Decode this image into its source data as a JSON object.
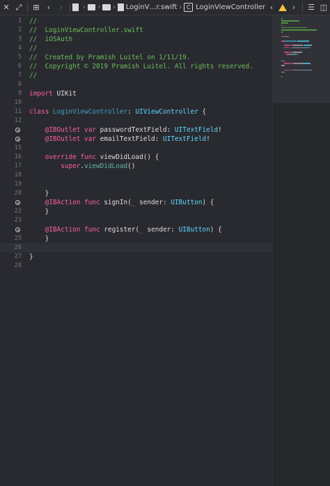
{
  "toolbar": {
    "breadcrumb_file": "LoginV…r.swift",
    "breadcrumb_symbol": "LoginViewController",
    "class_badge": "C"
  },
  "editor": {
    "current_line": 26,
    "lines": [
      {
        "n": "1",
        "bp": false,
        "tokens": [
          {
            "c": "c-comment",
            "t": "//"
          }
        ]
      },
      {
        "n": "2",
        "bp": false,
        "tokens": [
          {
            "c": "c-comment",
            "t": "//  LoginViewController.swift"
          }
        ]
      },
      {
        "n": "3",
        "bp": false,
        "tokens": [
          {
            "c": "c-comment",
            "t": "//  iOSAuth"
          }
        ]
      },
      {
        "n": "4",
        "bp": false,
        "tokens": [
          {
            "c": "c-comment",
            "t": "//"
          }
        ]
      },
      {
        "n": "5",
        "bp": false,
        "tokens": [
          {
            "c": "c-comment",
            "t": "//  Created by Pramish Luitel on 1/11/19."
          }
        ]
      },
      {
        "n": "6",
        "bp": false,
        "tokens": [
          {
            "c": "c-comment",
            "t": "//  Copyright © 2019 Pramish Luitel. All rights reserved."
          }
        ]
      },
      {
        "n": "7",
        "bp": false,
        "tokens": [
          {
            "c": "c-comment",
            "t": "//"
          }
        ]
      },
      {
        "n": "8",
        "bp": false,
        "tokens": []
      },
      {
        "n": "9",
        "bp": false,
        "tokens": [
          {
            "c": "c-kw",
            "t": "import"
          },
          {
            "c": "c-plain",
            "t": " UIKit"
          }
        ]
      },
      {
        "n": "10",
        "bp": false,
        "tokens": []
      },
      {
        "n": "11",
        "bp": false,
        "tokens": [
          {
            "c": "c-kw",
            "t": "class"
          },
          {
            "c": "c-plain",
            "t": " "
          },
          {
            "c": "c-decl",
            "t": "LoginViewController"
          },
          {
            "c": "c-plain",
            "t": ": "
          },
          {
            "c": "c-type",
            "t": "UIViewController"
          },
          {
            "c": "c-plain",
            "t": " {"
          }
        ]
      },
      {
        "n": "12",
        "bp": false,
        "tokens": []
      },
      {
        "n": "",
        "bp": true,
        "tokens": [
          {
            "c": "c-plain",
            "t": "    "
          },
          {
            "c": "c-kw",
            "t": "@IBOutlet"
          },
          {
            "c": "c-plain",
            "t": " "
          },
          {
            "c": "c-kw",
            "t": "var"
          },
          {
            "c": "c-plain",
            "t": " "
          },
          {
            "c": "c-plain",
            "t": "passwordTextField"
          },
          {
            "c": "c-plain",
            "t": ": "
          },
          {
            "c": "c-type",
            "t": "UITextField"
          },
          {
            "c": "c-plain",
            "t": "!"
          }
        ]
      },
      {
        "n": "",
        "bp": true,
        "tokens": [
          {
            "c": "c-plain",
            "t": "    "
          },
          {
            "c": "c-kw",
            "t": "@IBOutlet"
          },
          {
            "c": "c-plain",
            "t": " "
          },
          {
            "c": "c-kw",
            "t": "var"
          },
          {
            "c": "c-plain",
            "t": " "
          },
          {
            "c": "c-plain",
            "t": "emailTextField"
          },
          {
            "c": "c-plain",
            "t": ": "
          },
          {
            "c": "c-type",
            "t": "UITextField"
          },
          {
            "c": "c-plain",
            "t": "!"
          }
        ]
      },
      {
        "n": "15",
        "bp": false,
        "tokens": []
      },
      {
        "n": "16",
        "bp": false,
        "tokens": [
          {
            "c": "c-plain",
            "t": "    "
          },
          {
            "c": "c-kw",
            "t": "override"
          },
          {
            "c": "c-plain",
            "t": " "
          },
          {
            "c": "c-kw",
            "t": "func"
          },
          {
            "c": "c-plain",
            "t": " "
          },
          {
            "c": "c-plain",
            "t": "viewDidLoad() {"
          }
        ]
      },
      {
        "n": "17",
        "bp": false,
        "tokens": [
          {
            "c": "c-plain",
            "t": "        "
          },
          {
            "c": "c-kw",
            "t": "super"
          },
          {
            "c": "c-plain",
            "t": "."
          },
          {
            "c": "c-call",
            "t": "viewDidLoad"
          },
          {
            "c": "c-plain",
            "t": "()"
          }
        ]
      },
      {
        "n": "18",
        "bp": false,
        "tokens": []
      },
      {
        "n": "19",
        "bp": false,
        "tokens": []
      },
      {
        "n": "20",
        "bp": false,
        "tokens": [
          {
            "c": "c-plain",
            "t": "    }"
          }
        ]
      },
      {
        "n": "",
        "bp": true,
        "tokens": [
          {
            "c": "c-plain",
            "t": "    "
          },
          {
            "c": "c-kw",
            "t": "@IBAction"
          },
          {
            "c": "c-plain",
            "t": " "
          },
          {
            "c": "c-kw",
            "t": "func"
          },
          {
            "c": "c-plain",
            "t": " "
          },
          {
            "c": "c-plain",
            "t": "signIn("
          },
          {
            "c": "c-kw",
            "t": "_"
          },
          {
            "c": "c-plain",
            "t": " sender: "
          },
          {
            "c": "c-type",
            "t": "UIButton"
          },
          {
            "c": "c-plain",
            "t": ") {"
          }
        ]
      },
      {
        "n": "22",
        "bp": false,
        "tokens": [
          {
            "c": "c-plain",
            "t": "    }"
          }
        ]
      },
      {
        "n": "23",
        "bp": false,
        "tokens": []
      },
      {
        "n": "",
        "bp": true,
        "tokens": [
          {
            "c": "c-plain",
            "t": "    "
          },
          {
            "c": "c-kw",
            "t": "@IBAction"
          },
          {
            "c": "c-plain",
            "t": " "
          },
          {
            "c": "c-kw",
            "t": "func"
          },
          {
            "c": "c-plain",
            "t": " "
          },
          {
            "c": "c-plain",
            "t": "register("
          },
          {
            "c": "c-kw",
            "t": "_"
          },
          {
            "c": "c-plain",
            "t": " sender: "
          },
          {
            "c": "c-type",
            "t": "UIButton"
          },
          {
            "c": "c-plain",
            "t": ") {"
          }
        ]
      },
      {
        "n": "25",
        "bp": false,
        "tokens": [
          {
            "c": "c-plain",
            "t": "    }"
          }
        ]
      },
      {
        "n": "26",
        "bp": false,
        "tokens": []
      },
      {
        "n": "27",
        "bp": false,
        "tokens": [
          {
            "c": "c-plain",
            "t": "}"
          }
        ]
      },
      {
        "n": "28",
        "bp": false,
        "tokens": []
      }
    ]
  },
  "colors": {
    "background": "#292a30",
    "comment": "#6bbf59",
    "keyword": "#fc5fa3",
    "type": "#5dd8ff",
    "declaration": "#41a1c0",
    "warning": "#f3c33a"
  }
}
